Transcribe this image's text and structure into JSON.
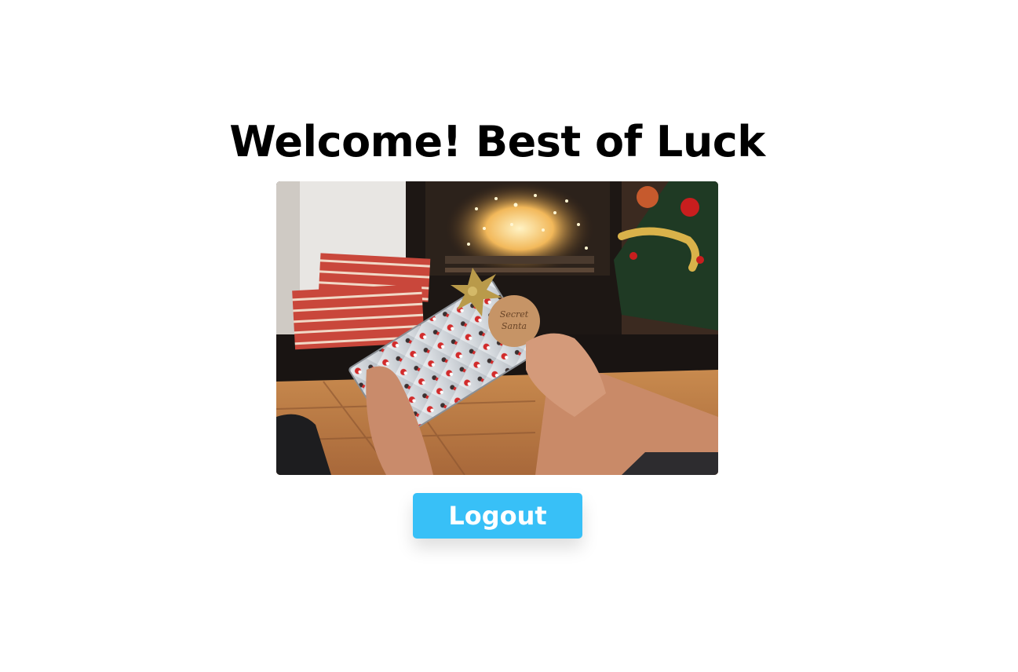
{
  "header": {
    "title": "Welcome! Best of Luck"
  },
  "hero_image": {
    "tag_text": "Secret Santa"
  },
  "actions": {
    "logout_label": "Logout",
    "logout_color": "#38c0f7"
  }
}
